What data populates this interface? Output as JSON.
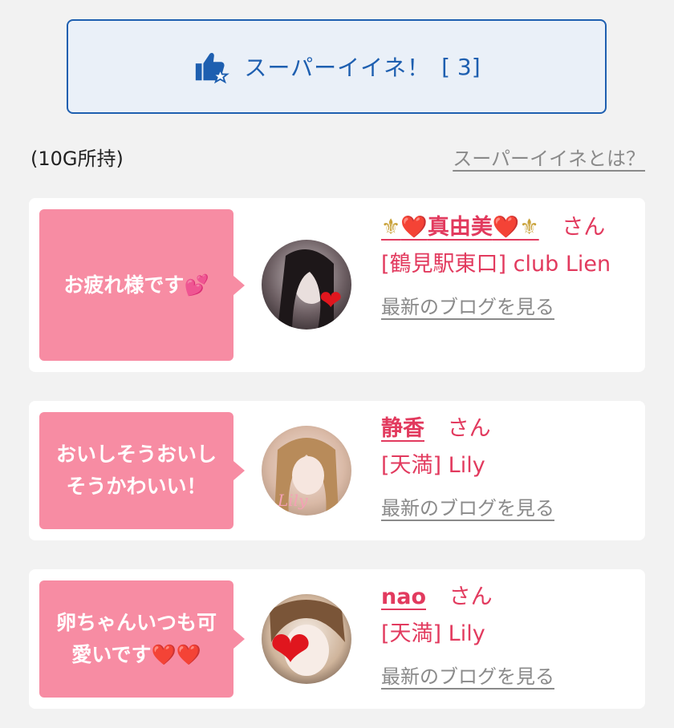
{
  "super_button": {
    "label": "スーパーイイネ！",
    "count": "[ 3]",
    "icon": "thumbs-up-star-icon"
  },
  "holding": "(10G所持)",
  "what_link": "スーパーイイネとは？",
  "cards": [
    {
      "message_text": "お疲れ様です",
      "message_emoji": "💕",
      "name_prefix": "⚜",
      "name_heart_left": "❤️",
      "name": "真由美",
      "name_heart_right": "❤️",
      "name_suffix": "⚜",
      "honorific": "さん",
      "shop": "[鶴見駅東口] club Lien",
      "blog_link": "最新のブログを見る"
    },
    {
      "message_text": "おいしそうおいしそうかわいい！",
      "name": "静香",
      "honorific": "さん",
      "shop": "[天満] Lily",
      "blog_link": "最新のブログを見る"
    },
    {
      "message_text": "卵ちゃんいつも可愛いです",
      "message_emoji": "❤️❤️",
      "name": "nao",
      "honorific": "さん",
      "shop": "[天満] Lily",
      "blog_link": "最新のブログを見る"
    }
  ],
  "colors": {
    "accent_blue": "#1e5fb0",
    "bubble_pink": "#f78ca3",
    "name_pink": "#e23a5e",
    "link_gray": "#8a8a8a"
  }
}
